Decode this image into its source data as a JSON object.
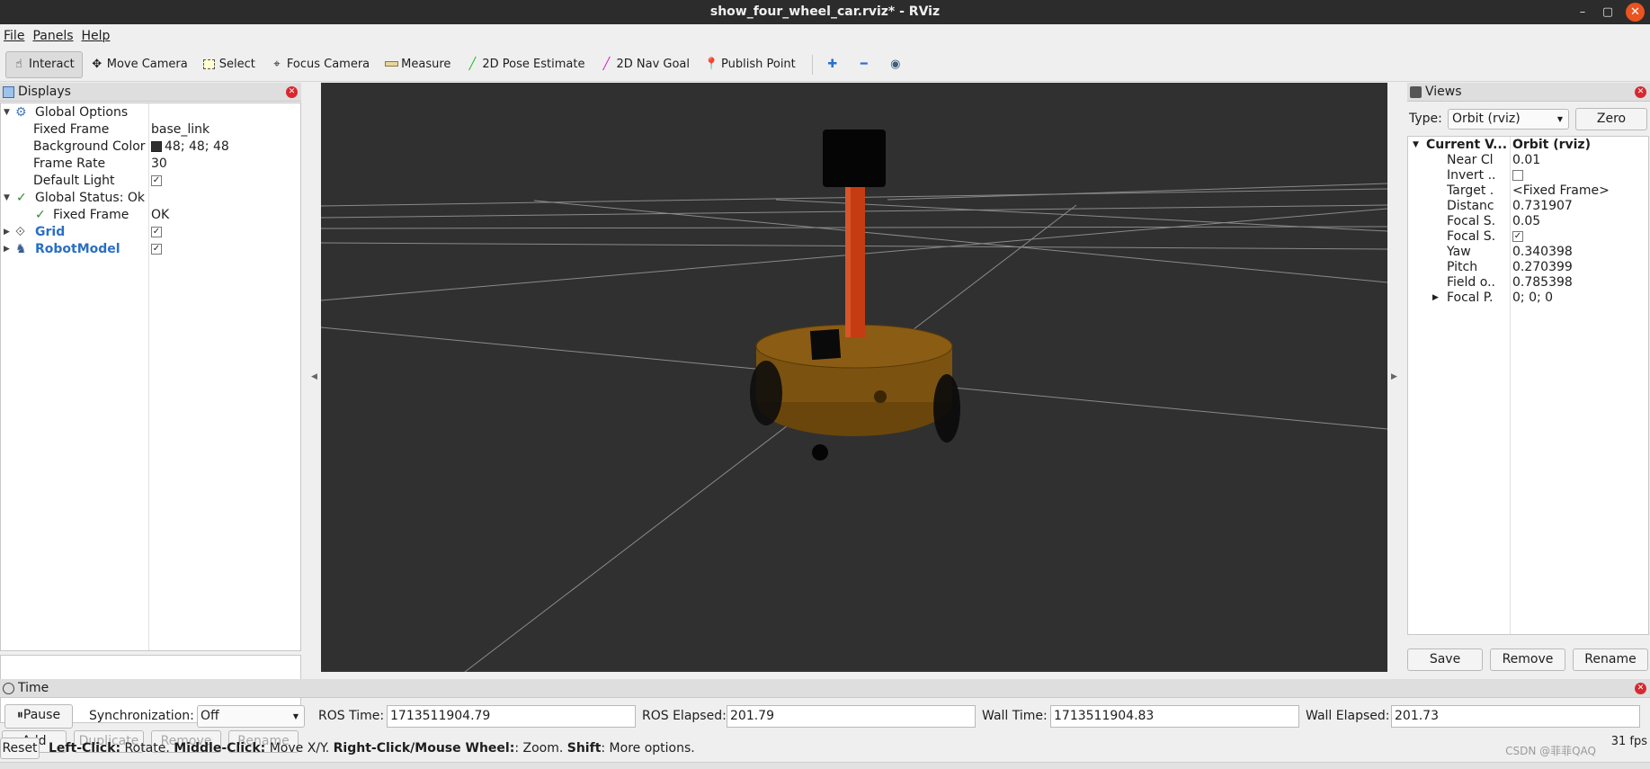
{
  "window": {
    "title": "show_four_wheel_car.rviz* - RViz",
    "minimize": "–",
    "restore": "▢",
    "close": "✕"
  },
  "menu": [
    "File",
    "Panels",
    "Help"
  ],
  "toolbar": {
    "tools": [
      {
        "label": "Interact",
        "icon": "hand-pointer-icon",
        "active": true
      },
      {
        "label": "Move Camera",
        "icon": "move-arrows-icon"
      },
      {
        "label": "Select",
        "icon": "select-box-icon"
      },
      {
        "label": "Focus Camera",
        "icon": "focus-target-icon"
      },
      {
        "label": "Measure",
        "icon": "ruler-icon"
      },
      {
        "label": "2D Pose Estimate",
        "icon": "green-arrow-icon"
      },
      {
        "label": "2D Nav Goal",
        "icon": "magenta-arrow-icon"
      },
      {
        "label": "Publish Point",
        "icon": "map-pin-icon"
      }
    ],
    "extra_icons": [
      "plus-icon",
      "minus-icon",
      "eye-icon"
    ]
  },
  "displays": {
    "title": "Displays",
    "rows": [
      {
        "key": "Global Options",
        "value": "",
        "level": 0,
        "expanded": true,
        "icon": "gear-icon"
      },
      {
        "key": "Fixed Frame",
        "value": "base_link",
        "level": 1
      },
      {
        "key": "Background Color",
        "value": "48; 48; 48",
        "level": 1,
        "swatch": "#303030"
      },
      {
        "key": "Frame Rate",
        "value": "30",
        "level": 1
      },
      {
        "key": "Default Light",
        "value": "",
        "level": 1,
        "checkbox": true
      },
      {
        "key": "Global Status: Ok",
        "value": "",
        "level": 0,
        "expanded": true,
        "icon": "check-icon"
      },
      {
        "key": "Fixed Frame",
        "value": "OK",
        "level": 1,
        "icon": "check-icon"
      },
      {
        "key": "Grid",
        "value": "",
        "level": 0,
        "expanded": false,
        "icon": "grid-icon",
        "checkbox": true,
        "blue": true
      },
      {
        "key": "RobotModel",
        "value": "",
        "level": 0,
        "expanded": false,
        "icon": "robot-icon",
        "checkbox": true,
        "blue": true
      }
    ],
    "buttons": {
      "add": "Add",
      "duplicate": "Duplicate",
      "remove": "Remove",
      "rename": "Rename"
    }
  },
  "views": {
    "title": "Views",
    "type_label": "Type:",
    "type_value": "Orbit (rviz)",
    "zero_label": "Zero",
    "header": {
      "key": "Current V...",
      "value": "Orbit (rviz)"
    },
    "rows": [
      {
        "key": "Near Cl...",
        "value": "0.01"
      },
      {
        "key": "Invert ...",
        "value": "",
        "checkbox": false
      },
      {
        "key": "Target ...",
        "value": "<Fixed Frame>"
      },
      {
        "key": "Distance",
        "value": "0.731907"
      },
      {
        "key": "Focal S...",
        "value": "0.05"
      },
      {
        "key": "Focal S...",
        "value": "",
        "checkbox": true
      },
      {
        "key": "Yaw",
        "value": "0.340398"
      },
      {
        "key": "Pitch",
        "value": "0.270399"
      },
      {
        "key": "Field o...",
        "value": "0.785398"
      },
      {
        "key": "Focal P...",
        "value": "0; 0; 0",
        "expandable": true
      }
    ],
    "buttons": {
      "save": "Save",
      "remove": "Remove",
      "rename": "Rename"
    }
  },
  "time": {
    "title": "Time",
    "pause": "Pause",
    "sync_label": "Synchronization:",
    "sync_value": "Off",
    "ros_time_label": "ROS Time:",
    "ros_time": "1713511904.79",
    "ros_elapsed_label": "ROS Elapsed:",
    "ros_elapsed": "201.79",
    "wall_time_label": "Wall Time:",
    "wall_time": "1713511904.83",
    "wall_elapsed_label": "Wall Elapsed:",
    "wall_elapsed": "201.73"
  },
  "status": {
    "reset": "Reset",
    "hint_parts": [
      {
        "b": "Left-Click:",
        "t": " Rotate. "
      },
      {
        "b": "Middle-Click:",
        "t": " Move X/Y. "
      },
      {
        "b": "Right-Click/Mouse Wheel:",
        "t": ": Zoom. "
      },
      {
        "b": "Shift",
        "t": ": More options."
      }
    ],
    "fps": "31 fps",
    "watermark": "CSDN @菲菲QAQ"
  },
  "colors": {
    "viewport_bg": "#303030",
    "grid_line": "#a0a0a0",
    "robot_body": "#8a5a10",
    "robot_pole": "#c23a10",
    "robot_dark": "#050505"
  }
}
